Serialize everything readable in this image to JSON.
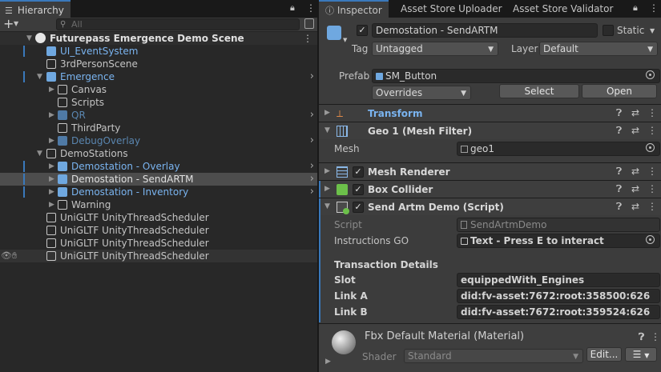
{
  "hierarchy": {
    "tab_label": "Hierarchy",
    "search_placeholder": "All",
    "scene_name": "Futurepass Emergence Demo Scene",
    "items": [
      {
        "label": "UI_EventSystem"
      },
      {
        "label": "3rdPersonScene"
      },
      {
        "label": "Emergence"
      },
      {
        "label": "Canvas"
      },
      {
        "label": "Scripts"
      },
      {
        "label": "QR"
      },
      {
        "label": "ThirdParty"
      },
      {
        "label": "DebugOverlay"
      },
      {
        "label": "DemoStations"
      },
      {
        "label": "Demostation - Overlay"
      },
      {
        "label": "Demostation - SendARTM"
      },
      {
        "label": "Demostation - Inventory"
      },
      {
        "label": "Warning"
      },
      {
        "label": "UniGLTF UnityThreadScheduler"
      },
      {
        "label": "UniGLTF UnityThreadScheduler"
      },
      {
        "label": "UniGLTF UnityThreadScheduler"
      },
      {
        "label": "UniGLTF UnityThreadScheduler"
      }
    ]
  },
  "inspector": {
    "tabs": [
      "Inspector",
      "Asset Store Uploader",
      "Asset Store Validator"
    ],
    "object_name": "Demostation - SendARTM",
    "static_label": "Static",
    "tag_label": "Tag",
    "tag_value": "Untagged",
    "layer_label": "Layer",
    "layer_value": "Default",
    "prefab_label": "Prefab",
    "prefab_value": "SM_Button",
    "overrides_label": "Overrides",
    "select_label": "Select",
    "open_label": "Open",
    "components": {
      "transform": "Transform",
      "mesh_filter": "Geo 1 (Mesh Filter)",
      "mesh_label": "Mesh",
      "mesh_value": "geo1",
      "mesh_renderer": "Mesh Renderer",
      "box_collider": "Box Collider",
      "script_comp": "Send Artm Demo (Script)",
      "script_label": "Script",
      "script_value": "SendArtmDemo",
      "instructions_label": "Instructions GO",
      "instructions_value": "Text - Press E to interact",
      "transaction_header": "Transaction Details",
      "slot_label": "Slot",
      "slot_value": "equippedWith_Engines",
      "linka_label": "Link A",
      "linka_value": "did:fv-asset:7672:root:358500:626",
      "linkb_label": "Link B",
      "linkb_value": "did:fv-asset:7672:root:359524:626",
      "material_name": "Fbx Default Material (Material)",
      "shader_label": "Shader",
      "shader_value": "Standard",
      "edit_label": "Edit..."
    }
  },
  "colors": {
    "accent": "#3a79bb",
    "prefab_blue": "#7ab4f0",
    "bg_dark": "#282828",
    "bg_panel": "#3c3c3c"
  }
}
